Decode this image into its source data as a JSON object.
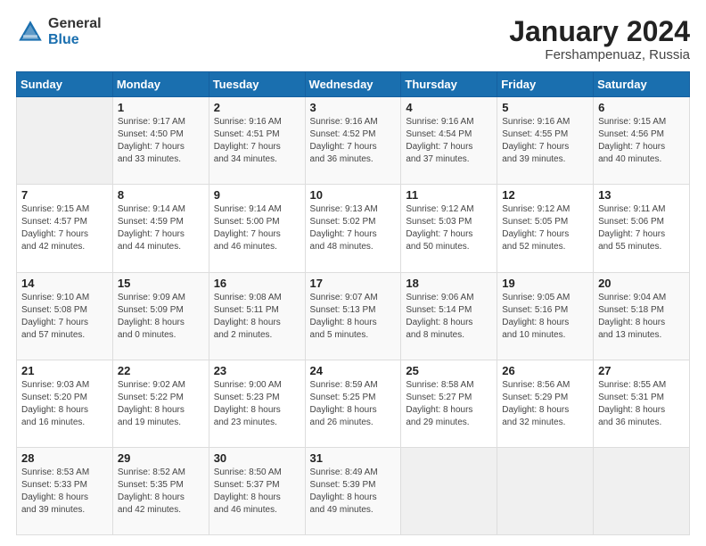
{
  "logo": {
    "general": "General",
    "blue": "Blue"
  },
  "title": "January 2024",
  "subtitle": "Fershampenuaz, Russia",
  "days_header": [
    "Sunday",
    "Monday",
    "Tuesday",
    "Wednesday",
    "Thursday",
    "Friday",
    "Saturday"
  ],
  "weeks": [
    [
      {
        "num": "",
        "info": ""
      },
      {
        "num": "1",
        "info": "Sunrise: 9:17 AM\nSunset: 4:50 PM\nDaylight: 7 hours\nand 33 minutes."
      },
      {
        "num": "2",
        "info": "Sunrise: 9:16 AM\nSunset: 4:51 PM\nDaylight: 7 hours\nand 34 minutes."
      },
      {
        "num": "3",
        "info": "Sunrise: 9:16 AM\nSunset: 4:52 PM\nDaylight: 7 hours\nand 36 minutes."
      },
      {
        "num": "4",
        "info": "Sunrise: 9:16 AM\nSunset: 4:54 PM\nDaylight: 7 hours\nand 37 minutes."
      },
      {
        "num": "5",
        "info": "Sunrise: 9:16 AM\nSunset: 4:55 PM\nDaylight: 7 hours\nand 39 minutes."
      },
      {
        "num": "6",
        "info": "Sunrise: 9:15 AM\nSunset: 4:56 PM\nDaylight: 7 hours\nand 40 minutes."
      }
    ],
    [
      {
        "num": "7",
        "info": "Sunrise: 9:15 AM\nSunset: 4:57 PM\nDaylight: 7 hours\nand 42 minutes."
      },
      {
        "num": "8",
        "info": "Sunrise: 9:14 AM\nSunset: 4:59 PM\nDaylight: 7 hours\nand 44 minutes."
      },
      {
        "num": "9",
        "info": "Sunrise: 9:14 AM\nSunset: 5:00 PM\nDaylight: 7 hours\nand 46 minutes."
      },
      {
        "num": "10",
        "info": "Sunrise: 9:13 AM\nSunset: 5:02 PM\nDaylight: 7 hours\nand 48 minutes."
      },
      {
        "num": "11",
        "info": "Sunrise: 9:12 AM\nSunset: 5:03 PM\nDaylight: 7 hours\nand 50 minutes."
      },
      {
        "num": "12",
        "info": "Sunrise: 9:12 AM\nSunset: 5:05 PM\nDaylight: 7 hours\nand 52 minutes."
      },
      {
        "num": "13",
        "info": "Sunrise: 9:11 AM\nSunset: 5:06 PM\nDaylight: 7 hours\nand 55 minutes."
      }
    ],
    [
      {
        "num": "14",
        "info": "Sunrise: 9:10 AM\nSunset: 5:08 PM\nDaylight: 7 hours\nand 57 minutes."
      },
      {
        "num": "15",
        "info": "Sunrise: 9:09 AM\nSunset: 5:09 PM\nDaylight: 8 hours\nand 0 minutes."
      },
      {
        "num": "16",
        "info": "Sunrise: 9:08 AM\nSunset: 5:11 PM\nDaylight: 8 hours\nand 2 minutes."
      },
      {
        "num": "17",
        "info": "Sunrise: 9:07 AM\nSunset: 5:13 PM\nDaylight: 8 hours\nand 5 minutes."
      },
      {
        "num": "18",
        "info": "Sunrise: 9:06 AM\nSunset: 5:14 PM\nDaylight: 8 hours\nand 8 minutes."
      },
      {
        "num": "19",
        "info": "Sunrise: 9:05 AM\nSunset: 5:16 PM\nDaylight: 8 hours\nand 10 minutes."
      },
      {
        "num": "20",
        "info": "Sunrise: 9:04 AM\nSunset: 5:18 PM\nDaylight: 8 hours\nand 13 minutes."
      }
    ],
    [
      {
        "num": "21",
        "info": "Sunrise: 9:03 AM\nSunset: 5:20 PM\nDaylight: 8 hours\nand 16 minutes."
      },
      {
        "num": "22",
        "info": "Sunrise: 9:02 AM\nSunset: 5:22 PM\nDaylight: 8 hours\nand 19 minutes."
      },
      {
        "num": "23",
        "info": "Sunrise: 9:00 AM\nSunset: 5:23 PM\nDaylight: 8 hours\nand 23 minutes."
      },
      {
        "num": "24",
        "info": "Sunrise: 8:59 AM\nSunset: 5:25 PM\nDaylight: 8 hours\nand 26 minutes."
      },
      {
        "num": "25",
        "info": "Sunrise: 8:58 AM\nSunset: 5:27 PM\nDaylight: 8 hours\nand 29 minutes."
      },
      {
        "num": "26",
        "info": "Sunrise: 8:56 AM\nSunset: 5:29 PM\nDaylight: 8 hours\nand 32 minutes."
      },
      {
        "num": "27",
        "info": "Sunrise: 8:55 AM\nSunset: 5:31 PM\nDaylight: 8 hours\nand 36 minutes."
      }
    ],
    [
      {
        "num": "28",
        "info": "Sunrise: 8:53 AM\nSunset: 5:33 PM\nDaylight: 8 hours\nand 39 minutes."
      },
      {
        "num": "29",
        "info": "Sunrise: 8:52 AM\nSunset: 5:35 PM\nDaylight: 8 hours\nand 42 minutes."
      },
      {
        "num": "30",
        "info": "Sunrise: 8:50 AM\nSunset: 5:37 PM\nDaylight: 8 hours\nand 46 minutes."
      },
      {
        "num": "31",
        "info": "Sunrise: 8:49 AM\nSunset: 5:39 PM\nDaylight: 8 hours\nand 49 minutes."
      },
      {
        "num": "",
        "info": ""
      },
      {
        "num": "",
        "info": ""
      },
      {
        "num": "",
        "info": ""
      }
    ]
  ]
}
